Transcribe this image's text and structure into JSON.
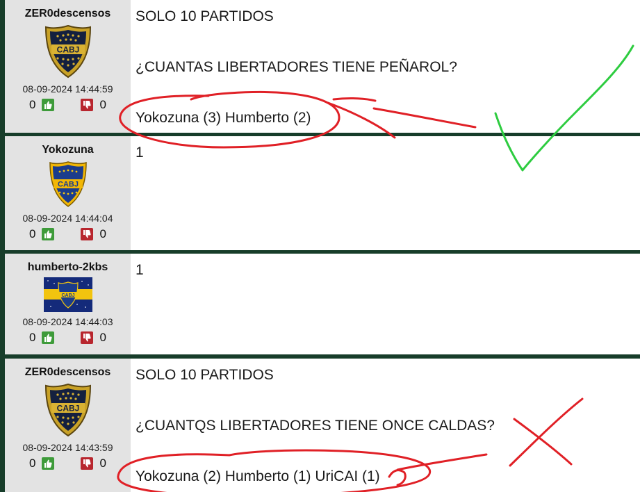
{
  "colors": {
    "page_background": "#173d2a",
    "sidebar_background": "#e3e3e3",
    "thumb_up": "#3e9b3a",
    "thumb_down": "#b8262e",
    "annotation_red": "#e02026",
    "annotation_green": "#2ecc40"
  },
  "posts": [
    {
      "username": "ZER0descensos",
      "avatar": "cabj-gold-shield-icon",
      "date": "08-09-2024 14:44:59",
      "likes": "0",
      "dislikes": "0",
      "lines": [
        "SOLO 10 PARTIDOS",
        "¿CUANTAS LIBERTADORES TIENE PEÑAROL?",
        "Yokozuna (3) Humberto (2)"
      ]
    },
    {
      "username": "Yokozuna",
      "avatar": "cabj-blue-shield-icon",
      "date": "08-09-2024 14:44:04",
      "likes": "0",
      "dislikes": "0",
      "lines": [
        "1"
      ]
    },
    {
      "username": "humberto-2kbs",
      "avatar": "cabj-flag-icon",
      "date": "08-09-2024 14:44:03",
      "likes": "0",
      "dislikes": "0",
      "lines": [
        "1"
      ]
    },
    {
      "username": "ZER0descensos",
      "avatar": "cabj-gold-shield-icon",
      "date": "08-09-2024 14:43:59",
      "likes": "0",
      "dislikes": "0",
      "lines": [
        "SOLO 10 PARTIDOS",
        "¿CUANTQS LIBERTADORES TIENE ONCE CALDAS?",
        "Yokozuna (2) Humberto (1) UriCAI (1)"
      ]
    }
  ]
}
